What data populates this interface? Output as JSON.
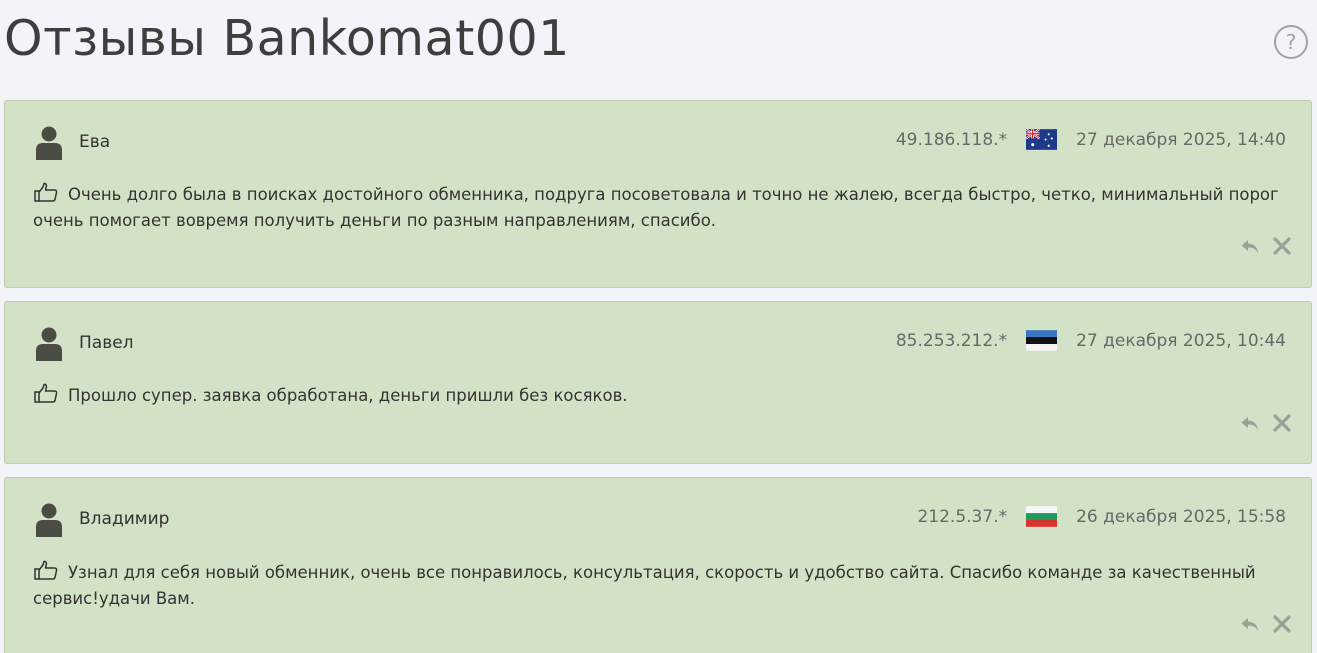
{
  "page": {
    "title": "Отзывы Bankomat001",
    "help_label": "?"
  },
  "reviews": [
    {
      "author": "Ева",
      "ip": "49.186.118.*",
      "flag": "australia-flag",
      "date": "27 декабря 2025, 14:40",
      "text": "Очень долго была в поисках достойного обменника, подруга посоветовала и точно не жалею, всегда быстро, четко, минимальный порог очень помогает вовремя получить деньги по разным направлениям, спасибо."
    },
    {
      "author": "Павел",
      "ip": "85.253.212.*",
      "flag": "estonia-flag",
      "date": "27 декабря 2025, 10:44",
      "text": "Прошло супер. заявка обработана, деньги пришли без косяков."
    },
    {
      "author": "Владимир",
      "ip": "212.5.37.*",
      "flag": "bulgaria-flag",
      "date": "26 декабря 2025, 15:58",
      "text": "Узнал для себя новый обменник, очень все понравилось, консультация, скорость и удобство сайта. Спасибо команде за качественный сервис!удачи Вам."
    }
  ],
  "colors": {
    "card_background": "#d3e2c6",
    "card_border": "#bfd0b0",
    "page_background": "#f2f4f9",
    "avatar": "#4b4d45",
    "action_icon": "#9aa197"
  },
  "icons": {
    "avatar": "user-silhouette-icon",
    "sentiment": "thumbs-up-icon",
    "reply": "reply-arrow-icon",
    "delete": "close-x-icon"
  }
}
